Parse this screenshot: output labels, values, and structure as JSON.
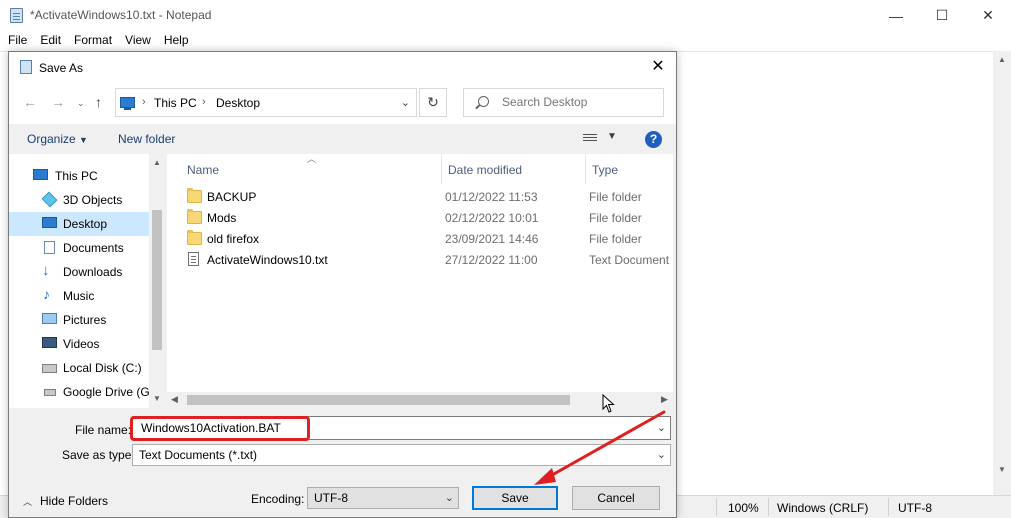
{
  "notepad": {
    "title": "*ActivateWindows10.txt - Notepad",
    "menu": [
      "File",
      "Edit",
      "Format",
      "View",
      "Help"
    ],
    "controls": {
      "minimize": "—",
      "maximize": "☐",
      "close": "✕"
    },
    "status": {
      "zoom": "100%",
      "line_ending": "Windows (CRLF)",
      "encoding": "UTF-8"
    }
  },
  "dialog": {
    "title": "Save As",
    "address": {
      "segments": [
        "This PC",
        "Desktop"
      ]
    },
    "search": {
      "placeholder": "Search Desktop"
    },
    "toolbar": {
      "organize": "Organize",
      "new_folder": "New folder",
      "help": "?"
    },
    "nav_items": [
      {
        "label": "This PC",
        "icon": "computer-icon"
      },
      {
        "label": "3D Objects",
        "icon": "cube-icon"
      },
      {
        "label": "Desktop",
        "icon": "desktop-icon",
        "selected": true
      },
      {
        "label": "Documents",
        "icon": "documents-icon"
      },
      {
        "label": "Downloads",
        "icon": "download-icon"
      },
      {
        "label": "Music",
        "icon": "music-icon"
      },
      {
        "label": "Pictures",
        "icon": "pictures-icon"
      },
      {
        "label": "Videos",
        "icon": "videos-icon"
      },
      {
        "label": "Local Disk (C:)",
        "icon": "drive-icon"
      },
      {
        "label": "Google Drive (G:",
        "icon": "drive-icon"
      }
    ],
    "columns": {
      "name": "Name",
      "date": "Date modified",
      "type": "Type"
    },
    "files": [
      {
        "name": "BACKUP",
        "date": "01/12/2022 11:53",
        "type": "File folder",
        "icon": "folder-icon"
      },
      {
        "name": "Mods",
        "date": "02/12/2022 10:01",
        "type": "File folder",
        "icon": "folder-icon"
      },
      {
        "name": "old firefox",
        "date": "23/09/2021 14:46",
        "type": "File folder",
        "icon": "folder-icon"
      },
      {
        "name": "ActivateWindows10.txt",
        "date": "27/12/2022 11:00",
        "type": "Text Document",
        "icon": "text-file-icon"
      }
    ],
    "file_name_label": "File name:",
    "file_name_value": "Windows10Activation.BAT",
    "save_type_label": "Save as type:",
    "save_type_value": "Text Documents (*.txt)",
    "hide_folders": "Hide Folders",
    "encoding_label": "Encoding:",
    "encoding_value": "UTF-8",
    "save_button": "Save",
    "cancel_button": "Cancel"
  },
  "colors": {
    "annotation_red": "#e02020",
    "selection_blue": "#cce8ff",
    "accent_blue": "#0078d7"
  }
}
